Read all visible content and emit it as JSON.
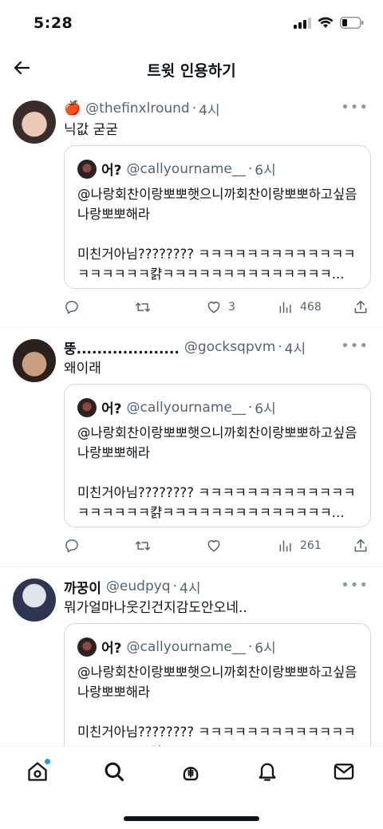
{
  "status": {
    "time": "5:28"
  },
  "header": {
    "title": "트윗 인용하기"
  },
  "tweets": [
    {
      "emoji": "🍎",
      "name": "",
      "handle": "@thefinxlround",
      "time": "4시",
      "text": "닉값 굳굳",
      "avatar_colors": [
        "#e9c7b4",
        "#3a2c2a"
      ],
      "quote": {
        "name": "어?",
        "handle": "@callyourname__",
        "time": "6시",
        "text": "@나랑회찬이랑뽀뽀햇으니까회찬이랑뽀뽀하고싶음나랑뽀뽀해라\n\n미친거아님???????? ㅋㅋㅋㅋㅋㅋㅋㅋㅋㅋㅋㅋㅋㅋㅋㅋㅋㅋㅋ캵ㅋㅋㅋㅋㅋㅋㅋㅋㅋㅋㅋㅋㅋㅋ..."
      },
      "replies": "",
      "retweets": "",
      "likes": "3",
      "views": "468"
    },
    {
      "emoji": "",
      "name": "뚱....................",
      "handle": "@gocksqpvm",
      "time": "4시",
      "text": "왜이래",
      "avatar_colors": [
        "#c79a7a",
        "#2a201c"
      ],
      "quote": {
        "name": "어?",
        "handle": "@callyourname__",
        "time": "6시",
        "text": "@나랑회찬이랑뽀뽀햇으니까회찬이랑뽀뽀하고싶음나랑뽀뽀해라\n\n미친거아님???????? ㅋㅋㅋㅋㅋㅋㅋㅋㅋㅋㅋㅋㅋㅋㅋㅋㅋㅋㅋ캵ㅋㅋㅋㅋㅋㅋㅋㅋㅋㅋㅋㅋㅋㅋ..."
      },
      "replies": "",
      "retweets": "",
      "likes": "",
      "views": "261"
    },
    {
      "emoji": "",
      "name": "까꿍이",
      "handle": "@eudpyq",
      "time": "4시",
      "text": "뭐가얼마나웃긴건지감도안오네..",
      "avatar_colors": [
        "#d8dce4",
        "#2d3550"
      ],
      "quote": {
        "name": "어?",
        "handle": "@callyourname__",
        "time": "6시",
        "text": "@나랑회찬이랑뽀뽀햇으니까회찬이랑뽀뽀하고싶음나랑뽀뽀해라\n\n미친거아님???????? ㅋㅋㅋㅋㅋㅋㅋㅋㅋㅋㅋㅋㅋㅋㅋㅋㅋㅋㅋ캵ㅋㅋㅋㅋㅋㅋㅋㅋㅋㅋㅋㅋㅋ"
      },
      "replies": "",
      "retweets": "",
      "likes": "",
      "views": ""
    }
  ],
  "tabbar": {
    "items": [
      "home-icon",
      "search-icon",
      "spaces-icon",
      "notifications-icon",
      "messages-icon"
    ],
    "accent": "#1d9bf0"
  },
  "colors": {
    "secondary_text": "#536471",
    "border": "#cfd9de"
  }
}
